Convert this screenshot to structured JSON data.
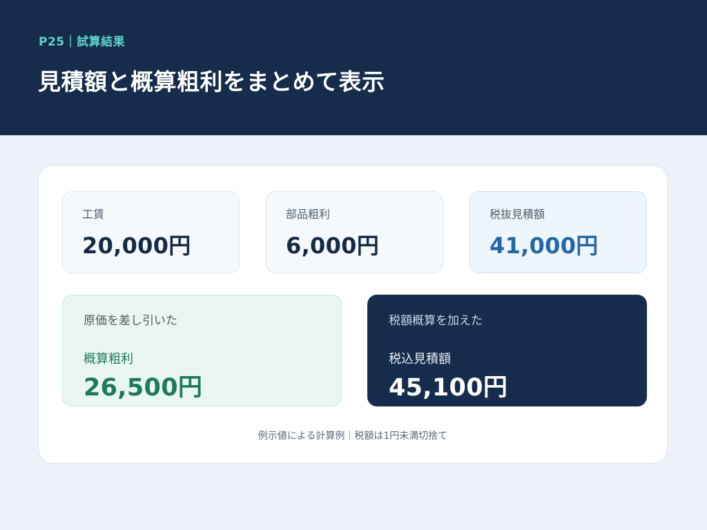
{
  "header": {
    "eyebrow": "P25｜試算結果",
    "title": "見積額と概算粗利をまとめて表示"
  },
  "cards": [
    {
      "label": "工賃",
      "value": "20,000円"
    },
    {
      "label": "部品粗利",
      "value": "6,000円"
    },
    {
      "label": "税抜見積額",
      "value": "41,000円"
    }
  ],
  "profit": {
    "caption": "原価を差し引いた",
    "label": "概算粗利",
    "value": "26,500円"
  },
  "total": {
    "caption": "税額概算を加えた",
    "label": "税込見積額",
    "value": "45,100円"
  },
  "note": "例示値による計算例｜税額は1円未満切捨て",
  "colors": {
    "navy": "#162c4c",
    "teal_accent": "#5fd3c9",
    "blue_value": "#2368a6",
    "green_value": "#1e7a5c"
  }
}
